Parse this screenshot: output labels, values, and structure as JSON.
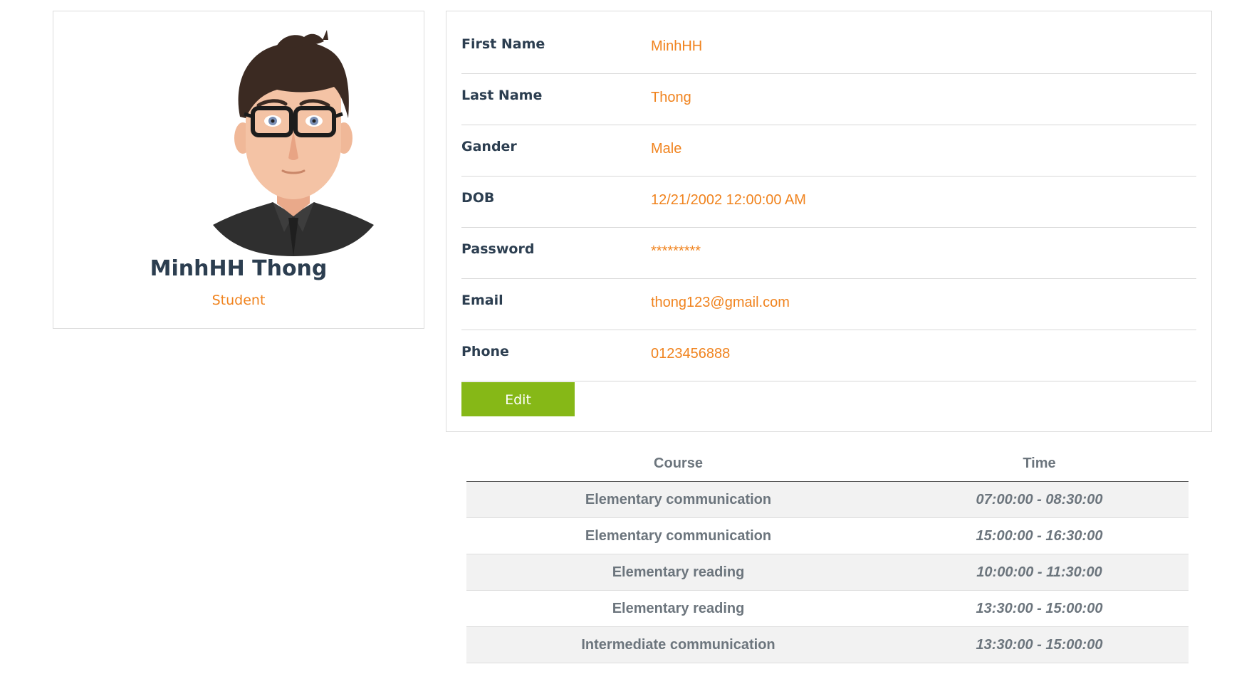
{
  "profile": {
    "name": "MinhHH Thong",
    "role": "Student"
  },
  "details": [
    {
      "label": "First Name",
      "value": "MinhHH"
    },
    {
      "label": "Last Name",
      "value": "Thong"
    },
    {
      "label": "Gander",
      "value": "Male"
    },
    {
      "label": "DOB",
      "value": "12/21/2002 12:00:00 AM"
    },
    {
      "label": "Password",
      "value": "*********"
    },
    {
      "label": "Email",
      "value": "thong123@gmail.com"
    },
    {
      "label": "Phone",
      "value": "0123456888"
    }
  ],
  "edit_button": {
    "label": "Edit"
  },
  "course_table": {
    "headers": {
      "course": "Course",
      "time": "Time"
    },
    "rows": [
      {
        "course": "Elementary communication",
        "time": "07:00:00 - 08:30:00"
      },
      {
        "course": "Elementary communication",
        "time": "15:00:00 - 16:30:00"
      },
      {
        "course": "Elementary reading",
        "time": "10:00:00 - 11:30:00"
      },
      {
        "course": "Elementary reading",
        "time": "13:30:00 - 15:00:00"
      },
      {
        "course": "Intermediate communication",
        "time": "13:30:00 - 15:00:00"
      }
    ]
  },
  "colors": {
    "accent": "#f0831e",
    "edit_button": "#86b817",
    "heading": "#2c3e50",
    "table_text": "#6c757d"
  },
  "icons": {
    "avatar": "cartoon-student-avatar-icon"
  }
}
